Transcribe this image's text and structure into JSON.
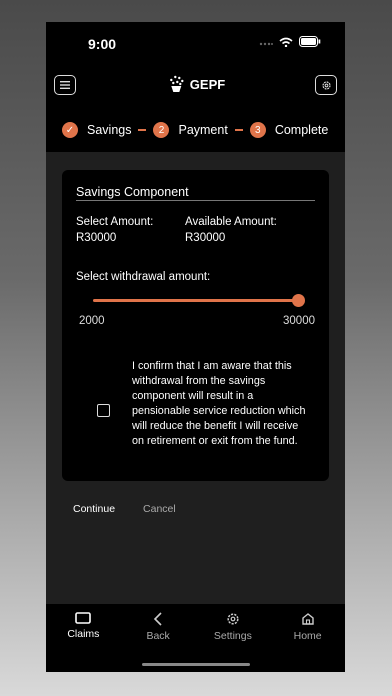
{
  "status_bar": {
    "time": "9:00"
  },
  "app_bar": {
    "brand": "GEPF",
    "menu_icon": "menu-icon",
    "settings_icon": "gear-icon"
  },
  "stepper": {
    "steps": [
      {
        "label": "Savings",
        "marker": "✓",
        "state": "done"
      },
      {
        "label": "Payment",
        "marker": "2",
        "state": "pending"
      },
      {
        "label": "Complete",
        "marker": "3",
        "state": "pending"
      }
    ]
  },
  "card": {
    "title": "Savings Component",
    "select_amount_label": "Select Amount:",
    "select_amount_value": "R30000",
    "available_amount_label": "Available Amount:",
    "available_amount_value": "R30000",
    "slider_label": "Select withdrawal amount:",
    "slider_min": "2000",
    "slider_max": "30000",
    "slider_value": 30000,
    "confirm_text": "I confirm that I am aware that this withdrawal from the savings component will result in a pensionable service reduction which will reduce the benefit I will receive on retirement or exit from the fund.",
    "confirm_checked": false
  },
  "actions": {
    "continue_label": "Continue",
    "cancel_label": "Cancel"
  },
  "tabs": [
    {
      "label": "Claims",
      "icon": "rectangle-icon",
      "active": true
    },
    {
      "label": "Back",
      "icon": "chevron-left-icon",
      "active": false
    },
    {
      "label": "Settings",
      "icon": "gear-icon",
      "active": false
    },
    {
      "label": "Home",
      "icon": "home-icon",
      "active": false
    }
  ],
  "colors": {
    "accent": "#e0744a",
    "background": "#1f1f1f",
    "surface": "#000000"
  }
}
